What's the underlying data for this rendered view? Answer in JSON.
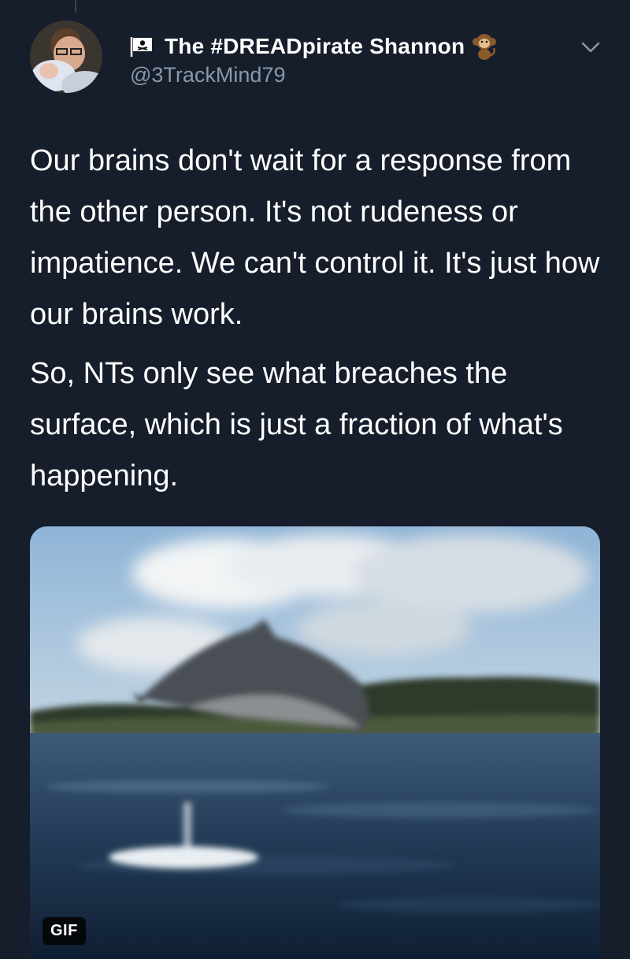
{
  "tweet": {
    "display_name": "The #DREADpirate Shannon",
    "handle": "@3TrackMind79",
    "paragraphs": [
      "Our brains don't wait for a response from the other person. It's not rudeness or impatience. We can't control it. It's just how our brains work.",
      "So, NTs only see what breaches the surface, which is just a fraction of what's happening."
    ],
    "media_badge": "GIF"
  },
  "icons": {
    "name_prefix": "pirate-flag-icon",
    "name_suffix": "monkey-emoji-icon",
    "menu": "chevron-down-icon"
  },
  "colors": {
    "background": "#161d2b",
    "text": "#ffffff",
    "handle": "#8899a6"
  }
}
